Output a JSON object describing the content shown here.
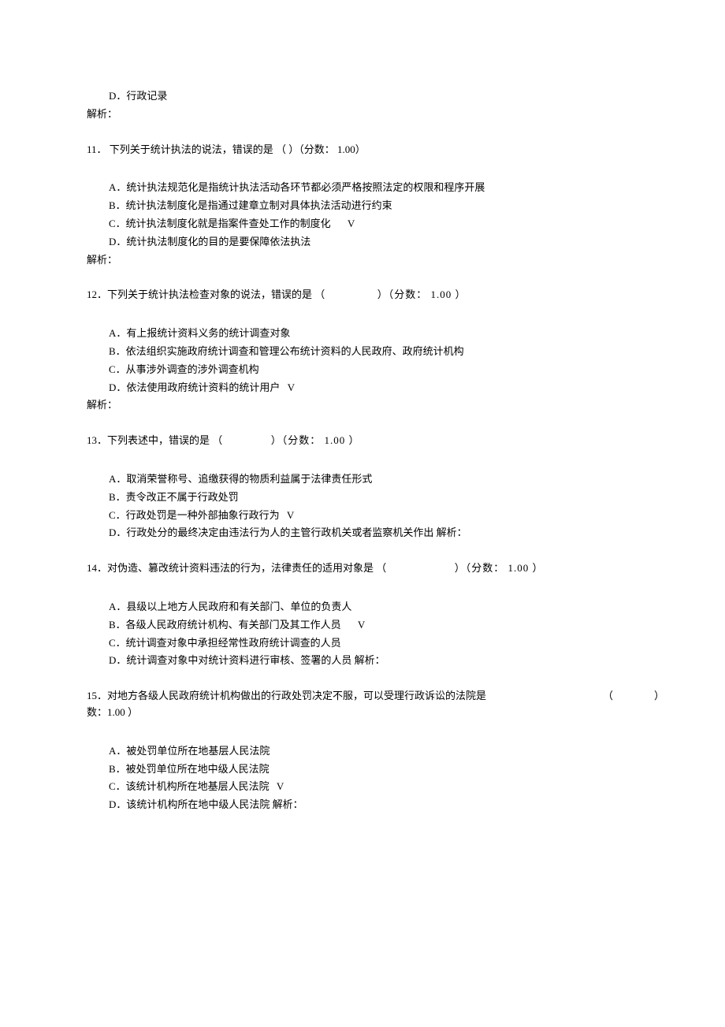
{
  "q10": {
    "optionD": "D．行政记录",
    "analysis": "解析："
  },
  "q11": {
    "stem": "11． 下列关于统计执法的说法，错误的是 （ ）（分数： 1.00）",
    "optionA": "A．统计执法规范化是指统计执法活动各环节都必须严格按照法定的权限和程序开展",
    "optionB": "B．统计执法制度化是指通过建章立制对具体执法活动进行约束",
    "optionC": "C．统计执法制度化就是指案件查处工作的制度化",
    "optionD": "D．统计执法制度化的目的是要保障依法执法",
    "analysis": "解析：",
    "checkmark": "V"
  },
  "q12": {
    "stem_pre": "12．下列关于统计执法检查对象的说法，错误的是 （",
    "stem_post": "）（分数： 1.00 ）",
    "optionA": "A．有上报统计资料义务的统计调查对象",
    "optionB": "B．依法组织实施政府统计调查和管理公布统计资料的人民政府、政府统计机构",
    "optionC": "C．从事涉外调查的涉外调查机构",
    "optionD": "D．依法使用政府统计资料的统计用户",
    "analysis": "解析：",
    "checkmark": "V"
  },
  "q13": {
    "stem_pre": "13．下列表述中，错误的是 （",
    "stem_post": "）（分数： 1.00 ）",
    "optionA": "A．取消荣誉称号、追缴获得的物质利益属于法律责任形式",
    "optionB": "B．责令改正不属于行政处罚",
    "optionC": "C．行政处罚是一种外部抽象行政行为",
    "optionD": "D．行政处分的最终决定由违法行为人的主管行政机关或者监察机关作出 解析：",
    "checkmark": "V"
  },
  "q14": {
    "stem_pre": "14．对伪造、篡改统计资料违法的行为，法律责任的适用对象是 （",
    "stem_post": "）（分数： 1.00 ）",
    "optionA": "A．县级以上地方人民政府和有关部门、单位的负责人",
    "optionB": "B．各级人民政府统计机构、有关部门及其工作人员",
    "optionC": "C．统计调查对象中承担经常性政府统计调查的人员",
    "optionD": "D．统计调查对象中对统计资料进行审核、签署的人员 解析：",
    "checkmark": "V"
  },
  "q15": {
    "stem_line1": "15．对地方各级人民政府统计机构做出的行政处罚决定不服，可以受理行政诉讼的法院是",
    "paren_left": "（",
    "paren_right": "）",
    "stem_line2": "数：1.00 ）",
    "optionA": "A．被处罚单位所在地基层人民法院",
    "optionB": "B．被处罚单位所在地中级人民法院",
    "optionC": "C．该统计机构所在地基层人民法院",
    "optionD": "D．该统计机构所在地中级人民法院 解析：",
    "checkmark": "V"
  }
}
